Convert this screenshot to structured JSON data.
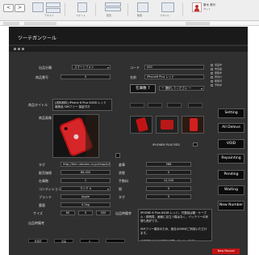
{
  "ribbon": {
    "nav_back": "<",
    "nav_forward": ">",
    "groups": [
      "テキスト",
      "フォント",
      "配置",
      "数値",
      "スタイル",
      "セル",
      "編集"
    ],
    "user_name": "藤木 美代",
    "user_status": "ネット"
  },
  "app": {
    "title": "ツーテガンツール"
  },
  "form": {
    "labels": {
      "category": "出品分類",
      "sku": "商品番号",
      "item_title": "商品タイトル",
      "image": "商品画像",
      "price": "販売価格",
      "stock": "在庫数",
      "shipping": "送料",
      "condition": "コンディション",
      "weight": "重量",
      "size": "サイズ",
      "brand": "ブランド",
      "store": "店舗",
      "note": "出品時備考",
      "code": "コード",
      "name": "名前",
      "warehouse": "倉庫",
      "status": "状態",
      "fee": "手数料",
      "tax": "税",
      "url_tag": "タグ"
    },
    "values": {
      "category": "スマートフォン",
      "sku": "0",
      "item_title": "[送料無料] iPhone 6 Plus 64GB レッド 極美品 SIMフリー 保証付き",
      "price": "86,400",
      "stock": "1",
      "shipping": "0",
      "condition": "ランク A",
      "weight": "0.2kg",
      "size": "60",
      "brand": "Apple",
      "store": "0",
      "note_a": "未選択",
      "note_b": "出品",
      "note_c": "0",
      "code": "000",
      "name": "iPhone6 Plus レッド",
      "id_badge": "在庫数 7",
      "select_hint": "ー 選択してください ー",
      "warehouse": "586",
      "status": "0",
      "fee": "14,100",
      "tax": "0",
      "tag": "0",
      "link": "http://item.rakuten.co.jp/shop/iphone6plus-red",
      "image_caption": "iPHONE6 PLUS   RED",
      "description": "iPHONE 6 Plus 64GB レッド。付属品は箱・ケーブル・説明書。画面に目立つ傷はなく、バッテリーの状態も良好です。\n\nSIMフリー端末のため、各社のSIMがご利用いただけます。\n\nご不明な点はお気軽にお問い合わせください。"
    },
    "side_buttons": [
      "Setting",
      "All Deleve",
      "VOID",
      "Repainting",
      "Pending",
      "Waiting",
      "New Number"
    ],
    "checkboxes": [
      "出品中",
      "未出品",
      "保留中",
      "売切れ",
      "削除済",
      "予約中"
    ],
    "footer_button": "New Record"
  },
  "colors": {
    "form_bg": "#303030",
    "titlebar_bg": "#1a1a1a",
    "accent_red": "#c21414"
  }
}
